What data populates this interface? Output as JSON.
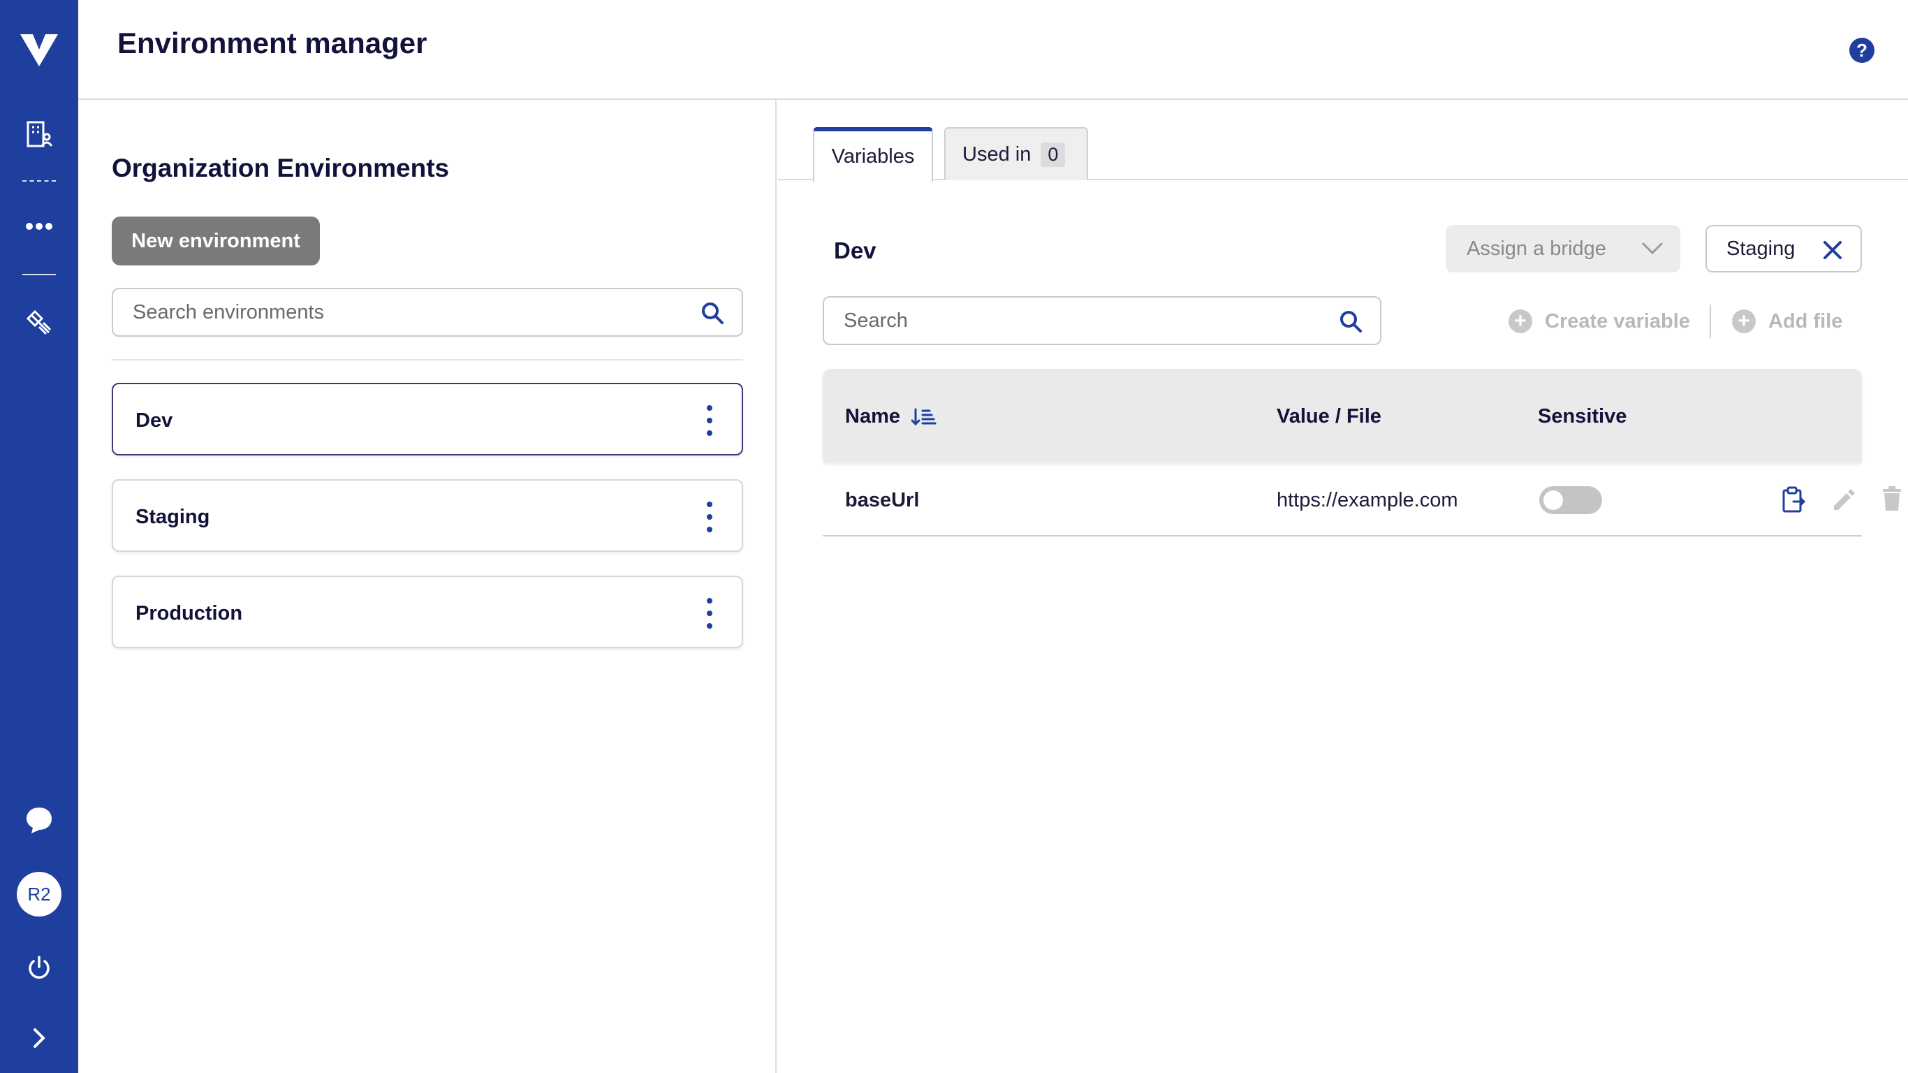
{
  "app": {
    "title": "Environment manager",
    "help_icon": "?",
    "accent_color": "#1e3f9e"
  },
  "sidebar": {
    "avatar_initials": "R2",
    "icons": [
      "logo-icon",
      "buildings-icon",
      "more-icon",
      "satellite-icon",
      "chat-icon",
      "power-icon",
      "chevron-right-icon"
    ]
  },
  "left": {
    "section_title": "Organization Environments",
    "new_button": "New environment",
    "search_placeholder": "Search environments",
    "environments": [
      {
        "name": "Dev",
        "active": true
      },
      {
        "name": "Staging",
        "active": false
      },
      {
        "name": "Production",
        "active": false
      }
    ]
  },
  "right": {
    "tabs": [
      {
        "label": "Variables",
        "active": true
      },
      {
        "label": "Used in",
        "count": "0",
        "active": false
      }
    ],
    "env_heading": "Dev",
    "bridge_placeholder": "Assign a bridge",
    "compare_chip": "Staging",
    "search_placeholder": "Search",
    "create_variable": "Create variable",
    "add_file": "Add file",
    "columns": {
      "name": "Name",
      "value": "Value / File",
      "sensitive": "Sensitive"
    },
    "rows": [
      {
        "name": "baseUrl",
        "value": "https://example.com",
        "sensitive": false
      }
    ]
  }
}
